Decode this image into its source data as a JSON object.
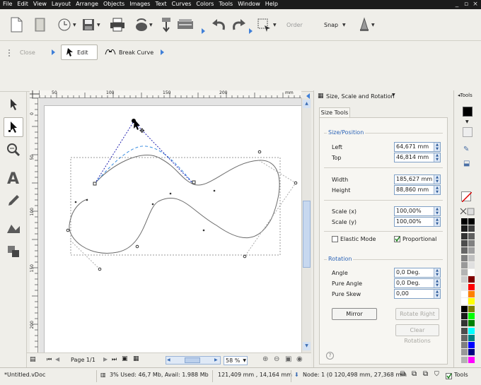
{
  "menu": [
    "File",
    "Edit",
    "View",
    "Layout",
    "Arrange",
    "Objects",
    "Images",
    "Text",
    "Curves",
    "Colors",
    "Tools",
    "Window",
    "Help"
  ],
  "toolbar": {
    "order_label": "Order",
    "snap_label": "Snap"
  },
  "context_toolbar": {
    "close_label": "Close",
    "edit_label": "Edit",
    "break_curve_label": "Break Curve"
  },
  "ruler": {
    "h_ticks": [
      "50",
      "100",
      "150",
      "200"
    ],
    "h_unit": "mm",
    "v_ticks": [
      "0",
      "50",
      "100",
      "150",
      "200"
    ]
  },
  "page_nav": {
    "label": "Page 1/1",
    "zoom": "58 %"
  },
  "panel": {
    "title": "Size, Scale and Rotation",
    "tools_label": "Tools",
    "tab": "Size Tools",
    "size_position_title": "Size/Position",
    "fields": {
      "left": {
        "label": "Left",
        "value": "64,671 mm"
      },
      "top": {
        "label": "Top",
        "value": "46,814 mm"
      },
      "width": {
        "label": "Width",
        "value": "185,627 mm"
      },
      "height": {
        "label": "Height",
        "value": "88,860 mm"
      },
      "scale_x": {
        "label": "Scale (x)",
        "value": "100,00%"
      },
      "scale_y": {
        "label": "Scale (y)",
        "value": "100,00%"
      }
    },
    "elastic_label": "Elastic Mode",
    "proportional_label": "Proportional",
    "elastic_checked": false,
    "proportional_checked": true,
    "rotation_title": "Rotation",
    "rotation": {
      "angle": {
        "label": "Angle",
        "value": "0,0 Deg."
      },
      "pure_angle": {
        "label": "Pure Angle",
        "value": "0,0 Deg."
      },
      "pure_skew": {
        "label": "Pure Skew",
        "value": "0,00"
      }
    },
    "mirror_label": "Mirror",
    "rotate_right_label": "Rotate Right",
    "clear_rotations_label": "Clear Rotations",
    "help_glyph": "?"
  },
  "palette": {
    "colors": [
      "#000000",
      "#404040",
      "#606060",
      "#808080",
      "#a0a0a0",
      "#c0c0c0",
      "#e0e0e0",
      "#ffffff",
      "#800000",
      "#ff0000",
      "#ff8000",
      "#ffff00",
      "#808000",
      "#00ff00",
      "#008000",
      "#00ffff",
      "#008080",
      "#0000ff",
      "#000080",
      "#ff00ff",
      "#800080",
      "#ff80ff",
      "#804000",
      "#ffffff"
    ],
    "grays": [
      "#000000",
      "#1a1a1a",
      "#333333",
      "#4d4d4d",
      "#666666",
      "#808080",
      "#999999",
      "#b3b3b3",
      "#cccccc",
      "#e6e6e6",
      "#ffffff",
      "#ffffff"
    ]
  },
  "status": {
    "file": "*Untitled.vDoc",
    "memory": "3%  Used: 46,7 Mb, Avail: 1.988 Mb",
    "coords": "121,409 mm , 14,164 mm",
    "node": "Node: 1 (0  120,498 mm, 27,368 mm",
    "tools_label": "Tools"
  },
  "colors": {
    "accent": "#3f7fd8",
    "menubar": "#1c1c1c",
    "group_title": "#2c64b7"
  }
}
